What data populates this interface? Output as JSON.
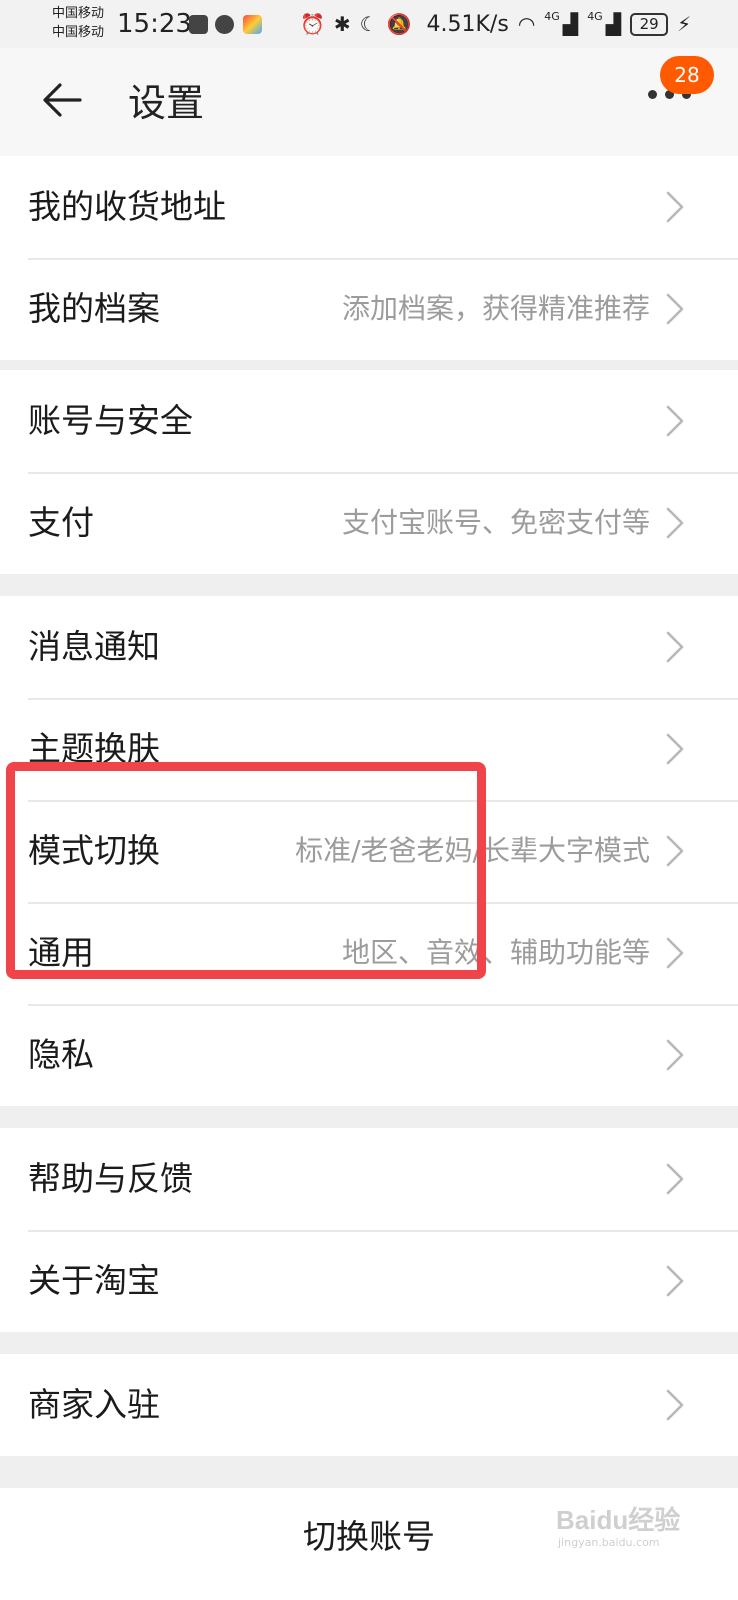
{
  "status_bar": {
    "carrier_1": "中国移动",
    "carrier_2": "中国移动",
    "time": "15:23",
    "net_speed": "4.51K/s",
    "signal_1": "4G",
    "signal_2": "4G",
    "battery": "29"
  },
  "header": {
    "title": "设置",
    "badge": "28"
  },
  "groups": [
    {
      "items": [
        {
          "label": "我的收货地址",
          "sub": ""
        },
        {
          "label": "我的档案",
          "sub": "添加档案，获得精准推荐"
        }
      ]
    },
    {
      "items": [
        {
          "label": "账号与安全",
          "sub": ""
        },
        {
          "label": "支付",
          "sub": "支付宝账号、免密支付等"
        }
      ]
    },
    {
      "items": [
        {
          "label": "消息通知",
          "sub": ""
        },
        {
          "label": "主题换肤",
          "sub": ""
        },
        {
          "label": "模式切换",
          "sub": "标准/老爸老妈/长辈大字模式"
        },
        {
          "label": "通用",
          "sub": "地区、音效、辅助功能等"
        },
        {
          "label": "隐私",
          "sub": ""
        }
      ]
    },
    {
      "items": [
        {
          "label": "帮助与反馈",
          "sub": ""
        },
        {
          "label": "关于淘宝",
          "sub": ""
        }
      ]
    },
    {
      "items": [
        {
          "label": "商家入驻",
          "sub": ""
        }
      ]
    }
  ],
  "bottom": {
    "switch_account": "切换账号"
  },
  "watermark": {
    "text": "Baidu经验",
    "url": "jingyan.baidu.com"
  },
  "colors": {
    "accent": "#ff5a00",
    "highlight": "#f0434a",
    "background": "#efefef"
  }
}
